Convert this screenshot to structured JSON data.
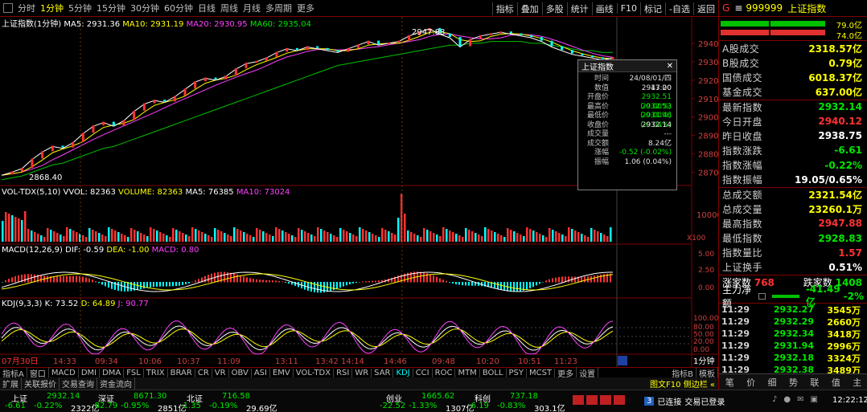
{
  "toolbar": {
    "left": [
      "分时",
      "1分钟",
      "5分钟",
      "15分钟",
      "30分钟",
      "60分钟",
      "日线",
      "周线",
      "月线",
      "多周期",
      "更多"
    ],
    "active": "1分钟",
    "right": [
      "指标",
      "叠加",
      "多股",
      "统计",
      "画线",
      "F10",
      "标记",
      "-自选",
      "返回"
    ]
  },
  "main_chart": {
    "title": "上证指数(1分钟)",
    "ma_labels": [
      "MA5: 2931.36",
      "MA10: 2931.19",
      "MA20: 2930.95",
      "MA60: 2935.04"
    ],
    "high_label": "2947.88",
    "low_label": "2868.40",
    "y_ticks": [
      "2940",
      "2930",
      "2920",
      "2910",
      "2900",
      "2890",
      "2880",
      "2870"
    ]
  },
  "volume_panel": {
    "title": "VOL-TDX(5,10)",
    "vvol": "VVOL: 82363",
    "volume": "VOLUME: 82363",
    "ma5": "MA5: 76385",
    "ma10": "MA10: 73024",
    "y_tick": "10000",
    "unit": "X100"
  },
  "macd_panel": {
    "title": "MACD(12,26,9)",
    "dif": "DIF: -0.59",
    "dea": "DEA: -1.00",
    "macd": "MACD: 0.80",
    "y_ticks": [
      "5.00",
      "2.50",
      "0.00"
    ]
  },
  "kdj_panel": {
    "title": "KDJ(9,3,3)",
    "k": "K: 73.52",
    "d": "D: 64.89",
    "j": "J: 90.77",
    "y_ticks": [
      "100.00",
      "80.00",
      "50.00",
      "20.00",
      "0.00"
    ]
  },
  "x_axis": {
    "labels": [
      "07月30日",
      "14:33",
      "09:34",
      "10:06",
      "10:37",
      "11:09",
      "13:11",
      "13:42",
      "14:14",
      "14:46",
      "09:48",
      "10:20",
      "10:51",
      "11:23"
    ],
    "period": "1分钟"
  },
  "popup": {
    "title": "上证指数",
    "rows": [
      {
        "k": "时间",
        "v": "24/08/01/四 13:00"
      },
      {
        "k": "数值",
        "v": "2947.20"
      },
      {
        "k": "开盘价",
        "v": "2932.51 (-0.00%)"
      },
      {
        "k": "最高价",
        "v": "2932.53 (-0.00%)"
      },
      {
        "k": "最低价",
        "v": "2931.46 (-0.04%)"
      },
      {
        "k": "收盘价",
        "v": "2932.14"
      },
      {
        "k": "成交量",
        "v": "---"
      },
      {
        "k": "成交额",
        "v": "8.24亿"
      },
      {
        "k": "涨幅",
        "v": "-0.52 (-0.02%)"
      },
      {
        "k": "振幅",
        "v": "1.06 (0.04%)"
      }
    ]
  },
  "indicator_tabs": [
    "指标A",
    "窗口",
    "MACD",
    "DMI",
    "DMA",
    "FSL",
    "TRIX",
    "BRAR",
    "CR",
    "VR",
    "OBV",
    "ASI",
    "EMV",
    "VOL-TDX",
    "RSI",
    "WR",
    "SAR",
    "KDJ",
    "CCI",
    "ROC",
    "MTM",
    "BOLL",
    "PSY",
    "MCST",
    "更多",
    "设置"
  ],
  "indicator_active": "KDJ",
  "indicator_right": [
    "指标B",
    "模板"
  ],
  "window_tabs": [
    "扩展",
    "关联报价",
    "交易查询",
    "资金流向"
  ],
  "window_right": "图文F10 侧边栏 «",
  "status": {
    "indices": [
      {
        "name": "上证",
        "value": "2932.14",
        "chg": "-6.61",
        "pct": "-0.22%",
        "amt": "2322亿"
      },
      {
        "name": "深证",
        "value": "8671.30",
        "chg": "-82.79",
        "pct": "-0.95%",
        "amt": "2851亿"
      },
      {
        "name": "北证",
        "value": "716.58",
        "chg": "-1.35",
        "pct": "-0.19%",
        "amt": "29.69亿"
      },
      {
        "name": "创业",
        "value": "1665.62",
        "chg": "-22.52",
        "pct": "-1.33%",
        "amt": "1307亿"
      },
      {
        "name": "科创",
        "value": "737.18",
        "chg": "-6.19",
        "pct": "-0.83%",
        "amt": "303.1亿"
      }
    ],
    "conn_badge": "3",
    "conn": "已连接",
    "trade": "交易已登录",
    "time": "12:22:12"
  },
  "right_panel": {
    "g": "G",
    "code": "999999",
    "name": "上证指数",
    "bar_vals": [
      "79.0亿",
      "74.0亿"
    ],
    "rows": [
      {
        "k": "A股成交",
        "v": "2318.57亿",
        "c": "yel"
      },
      {
        "k": "B股成交",
        "v": "0.79亿",
        "c": "yel"
      },
      {
        "k": "国债成交",
        "v": "6018.37亿",
        "c": "yel"
      },
      {
        "k": "基金成交",
        "v": "637.00亿",
        "c": "yel"
      },
      {
        "k": "最新指数",
        "v": "2932.14",
        "c": "grn"
      },
      {
        "k": "今日开盘",
        "v": "2940.12",
        "c": "red"
      },
      {
        "k": "昨日收盘",
        "v": "2938.75",
        "c": "wht"
      },
      {
        "k": "指数涨跌",
        "v": "-6.61",
        "c": "grn"
      },
      {
        "k": "指数涨幅",
        "v": "-0.22%",
        "c": "grn"
      },
      {
        "k": "指数振幅",
        "v": "19.05/0.65%",
        "c": "wht"
      },
      {
        "k": "总成交额",
        "v": "2321.54亿",
        "c": "yel"
      },
      {
        "k": "总成交量",
        "v": "23260.1万",
        "c": "yel"
      },
      {
        "k": "最高指数",
        "v": "2947.88",
        "c": "red"
      },
      {
        "k": "最低指数",
        "v": "2928.83",
        "c": "grn"
      },
      {
        "k": "指数量比",
        "v": "1.57",
        "c": "red"
      },
      {
        "k": "上证换手",
        "v": "0.51%",
        "c": "wht"
      }
    ],
    "rise_label": "涨家数",
    "rise": "768",
    "fall_label": "跌家数",
    "fall": "1408",
    "flow_label": "主力净额",
    "flow_val": "-41.49亿",
    "flow_pct": "-2%",
    "ticks": [
      {
        "t": "11:29",
        "p": "2932.27",
        "v": "3545万"
      },
      {
        "t": "11:29",
        "p": "2932.29",
        "v": "2660万"
      },
      {
        "t": "11:29",
        "p": "2932.34",
        "v": "3418万"
      },
      {
        "t": "11:29",
        "p": "2931.94",
        "v": "2996万"
      },
      {
        "t": "11:29",
        "p": "2932.18",
        "v": "3324万"
      },
      {
        "t": "11:29",
        "p": "2932.38",
        "v": "3489万"
      },
      {
        "t": "11:29",
        "p": "2932.34",
        "v": "3423万"
      },
      {
        "t": "11:29",
        "p": "2932.25",
        "v": "2803万"
      },
      {
        "t": "11:30",
        "p": "2932.14",
        "v": "2268万"
      }
    ],
    "bottom_tabs": [
      "笔",
      "价",
      "细",
      "势",
      "联",
      "值",
      "主"
    ]
  },
  "chart_data": {
    "type": "line",
    "title": "上证指数(1分钟)",
    "y_range": [
      2865,
      2950
    ],
    "close": [
      2868.4,
      2870,
      2872,
      2877,
      2881,
      2884,
      2883,
      2886,
      2891,
      2895,
      2897,
      2895,
      2898,
      2903,
      2907,
      2909,
      2908,
      2911,
      2915,
      2919,
      2921,
      2920,
      2922,
      2926,
      2929,
      2930,
      2932,
      2935,
      2937,
      2936,
      2938,
      2937,
      2936,
      2935,
      2937,
      2939,
      2941,
      2939,
      2940,
      2941,
      2944,
      2946,
      2947.88,
      2945,
      2943,
      2938,
      2942,
      2944,
      2945,
      2946,
      2945,
      2944,
      2943,
      2941,
      2938,
      2936,
      2934,
      2933,
      2932,
      2931,
      2932.14
    ],
    "ma60": [
      2866,
      2867,
      2868,
      2870,
      2872,
      2874,
      2875,
      2877,
      2879,
      2881,
      2883,
      2884,
      2886,
      2888,
      2890,
      2892,
      2894,
      2896,
      2898,
      2900,
      2902,
      2904,
      2906,
      2908,
      2910,
      2912,
      2914,
      2916,
      2918,
      2920,
      2922,
      2924,
      2926,
      2928,
      2929,
      2930,
      2931,
      2932,
      2933,
      2934,
      2935,
      2936,
      2937,
      2938,
      2939,
      2939,
      2940,
      2940,
      2941,
      2941,
      2941,
      2941,
      2940,
      2940,
      2939,
      2938,
      2937,
      2936,
      2936,
      2935,
      2935.04
    ]
  }
}
